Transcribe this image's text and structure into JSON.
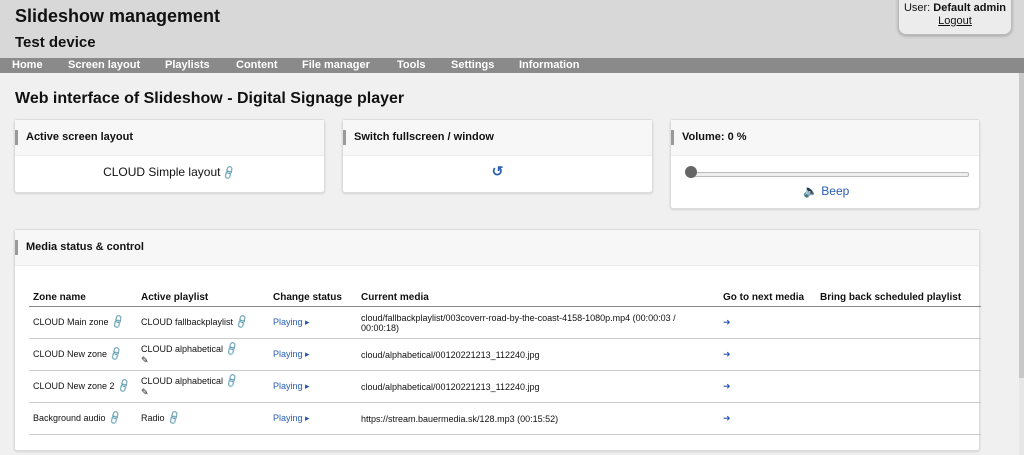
{
  "header": {
    "app_title": "Slideshow management",
    "device_name": "Test device",
    "user_label": "User:",
    "user_name": "Default admin",
    "logout_label": "Logout"
  },
  "nav": {
    "items": [
      "Home",
      "Screen layout",
      "Playlists",
      "Content",
      "File manager",
      "Tools",
      "Settings",
      "Information"
    ]
  },
  "main": {
    "heading": "Web interface of Slideshow - Digital Signage player",
    "layout_card": {
      "title": "Active screen layout",
      "value": "CLOUD Simple layout"
    },
    "fullscreen_card": {
      "title": "Switch fullscreen / window",
      "icon": "refresh-icon"
    },
    "volume_card": {
      "title": "Volume: 0 %",
      "volume_percent": 0,
      "beep_label": "Beep"
    },
    "media_card": {
      "title": "Media status & control",
      "columns": [
        "Zone name",
        "Active playlist",
        "Change status",
        "Current media",
        "Go to next media",
        "Bring back scheduled playlist"
      ],
      "rows": [
        {
          "zone": "CLOUD Main zone",
          "playlist": "CLOUD fallbackplaylist",
          "status": "Playing",
          "media": "cloud/fallbackplaylist/003coverr-road-by-the-coast-4158-1080p.mp4 (00:00:03 / 00:00:18)"
        },
        {
          "zone": "CLOUD New zone",
          "playlist": "CLOUD alphabetical",
          "status": "Playing",
          "media": "cloud/alphabetical/00120221213_112240.jpg"
        },
        {
          "zone": "CLOUD New zone 2",
          "playlist": "CLOUD alphabetical",
          "status": "Playing",
          "media": "cloud/alphabetical/00120221213_112240.jpg"
        },
        {
          "zone": "Background audio",
          "playlist": "Radio",
          "status": "Playing",
          "media": "https://stream.bauermedia.sk/128.mp3 (00:15:52)"
        }
      ]
    }
  },
  "colors": {
    "accent": "#2a5db0",
    "nav_bg": "#8a8a8a",
    "header_bg": "#d8d8d8"
  }
}
